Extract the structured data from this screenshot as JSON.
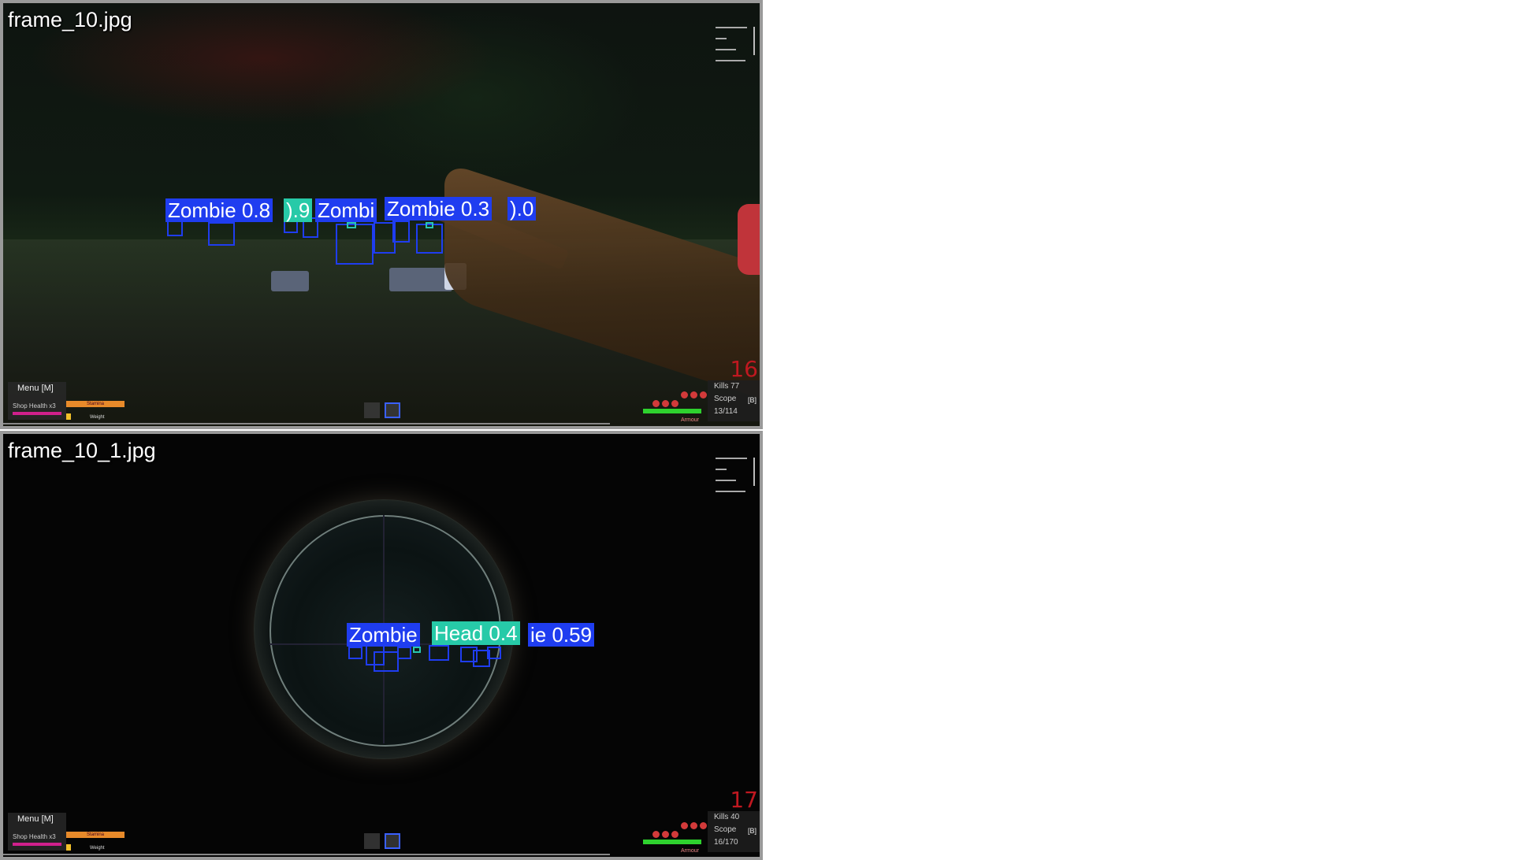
{
  "panels": {
    "top": {
      "filename": "frame_10.jpg",
      "detections": {
        "labels": [
          "Zombie 0.8",
          ").9",
          "Zombi",
          "Zombie 0.3",
          ").0"
        ]
      },
      "hud": {
        "menu": "Menu [M]",
        "shop": "Shop Health x3",
        "stamina": "Stamina",
        "weight": "Weight",
        "armour": "Armour",
        "kills": "Kills 77",
        "scope": "Scope",
        "scope_key": "[B]",
        "ammo_reserve": "13/114",
        "ammo_count": "16"
      }
    },
    "bottom": {
      "filename": "frame_10_1.jpg",
      "detections": {
        "labels": [
          "Zombie",
          "Head 0.4",
          "ie 0.59"
        ]
      },
      "hud": {
        "menu": "Menu [M]",
        "shop": "Shop Health x3",
        "stamina": "Stamina",
        "weight": "Weight",
        "armour": "Armour",
        "kills": "Kills 40",
        "scope": "Scope",
        "scope_key": "[B]",
        "ammo_reserve": "16/170",
        "ammo_count": "17"
      }
    }
  },
  "colors": {
    "zombie_box": "#1f3df0",
    "head_box": "#29c7b0",
    "ammo": "#c01820",
    "health_bar": "#d0208c",
    "stamina_bar": "#e88a2a",
    "armour_bar": "#2ed12e"
  }
}
